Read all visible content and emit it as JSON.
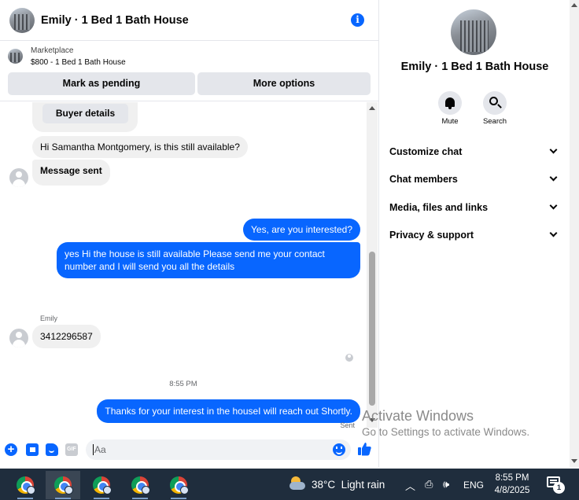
{
  "chat": {
    "title": "Emily · 1 Bed 1 Bath House",
    "marketplace_label": "Marketplace",
    "listing": "$800 - 1 Bed 1 Bath House",
    "mark_pending_label": "Mark as pending",
    "more_options_label": "More options",
    "buyer_details_label": "Buyer details",
    "messages": {
      "m1": "Hi Samantha Montgomery, is this still available?",
      "m2": "Message sent",
      "m3": "Yes, are you interested?",
      "m4": "yes Hi the house is still available Please send me your contact number and I will send you all the details",
      "sender_name": "Emily",
      "m5": "3412296587",
      "timestamp": "8:55 PM",
      "m6": "Thanks for your interest in the houseI will reach out Shortly.",
      "sent_label": "Sent"
    },
    "composer_placeholder": "Aa",
    "gif_label": "GIF"
  },
  "details": {
    "title": "Emily · 1 Bed 1 Bath House",
    "mute_label": "Mute",
    "search_label": "Search",
    "sections": [
      "Customize chat",
      "Chat members",
      "Media, files and links",
      "Privacy & support"
    ]
  },
  "watermark": {
    "line1": "Activate Windows",
    "line2": "Go to Settings to activate Windows."
  },
  "taskbar": {
    "weather": "38°C  Light rain",
    "language": "ENG",
    "time": "8:55 PM",
    "date": "4/8/2025",
    "notification_count": "1"
  },
  "colors": {
    "accent": "#0866ff",
    "bubble_in": "#f0f0f0",
    "button_bg": "#e4e6eb",
    "taskbar": "#1f2d3d"
  }
}
